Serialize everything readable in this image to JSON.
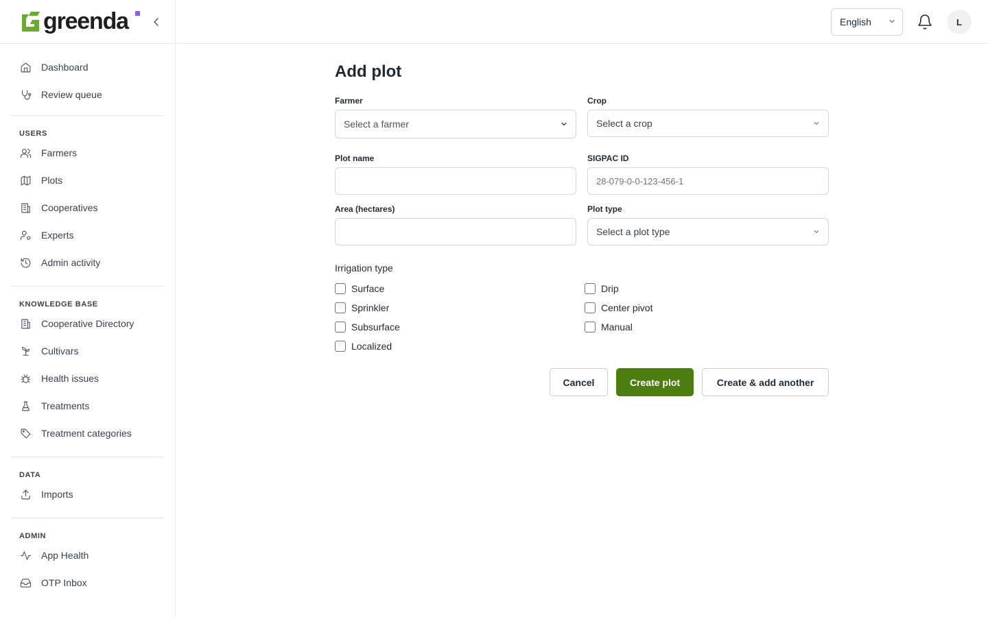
{
  "brand": {
    "name": "greenda",
    "accent": "#8b5cf6",
    "green": "#6aaa2e"
  },
  "sidebar": {
    "groups": [
      {
        "heading": "",
        "items": [
          {
            "label": "Dashboard",
            "icon": "home-icon"
          },
          {
            "label": "Review queue",
            "icon": "stethoscope-icon"
          }
        ]
      },
      {
        "heading": "USERS",
        "items": [
          {
            "label": "Farmers",
            "icon": "users-icon"
          },
          {
            "label": "Plots",
            "icon": "map-icon"
          },
          {
            "label": "Cooperatives",
            "icon": "building-icon"
          },
          {
            "label": "Experts",
            "icon": "user-cog-icon"
          },
          {
            "label": "Admin activity",
            "icon": "history-icon"
          }
        ]
      },
      {
        "heading": "KNOWLEDGE BASE",
        "items": [
          {
            "label": "Cooperative Directory",
            "icon": "building-icon"
          },
          {
            "label": "Cultivars",
            "icon": "sprout-icon"
          },
          {
            "label": "Health issues",
            "icon": "bug-icon"
          },
          {
            "label": "Treatments",
            "icon": "flask-icon"
          },
          {
            "label": "Treatment categories",
            "icon": "tag-icon"
          }
        ]
      },
      {
        "heading": "DATA",
        "items": [
          {
            "label": "Imports",
            "icon": "upload-icon"
          }
        ]
      },
      {
        "heading": "ADMIN",
        "items": [
          {
            "label": "App Health",
            "icon": "activity-icon"
          },
          {
            "label": "OTP Inbox",
            "icon": "inbox-icon"
          }
        ]
      }
    ]
  },
  "header": {
    "language": "English",
    "avatar_initial": "L"
  },
  "form": {
    "title": "Add plot",
    "farmer": {
      "label": "Farmer",
      "placeholder": "Select a farmer"
    },
    "crop": {
      "label": "Crop",
      "placeholder": "Select a crop"
    },
    "plot_name": {
      "label": "Plot name",
      "value": ""
    },
    "sigpac": {
      "label": "SIGPAC ID",
      "placeholder": "28-079-0-0-123-456-1"
    },
    "area": {
      "label": "Area (hectares)",
      "value": ""
    },
    "plot_type": {
      "label": "Plot type",
      "placeholder": "Select a plot type"
    },
    "irrigation": {
      "label": "Irrigation type",
      "left": [
        "Surface",
        "Sprinkler",
        "Subsurface",
        "Localized"
      ],
      "right": [
        "Drip",
        "Center pivot",
        "Manual"
      ]
    },
    "actions": {
      "cancel": "Cancel",
      "create": "Create plot",
      "create_another": "Create & add another"
    },
    "primary_color": "#4d7c0f"
  }
}
